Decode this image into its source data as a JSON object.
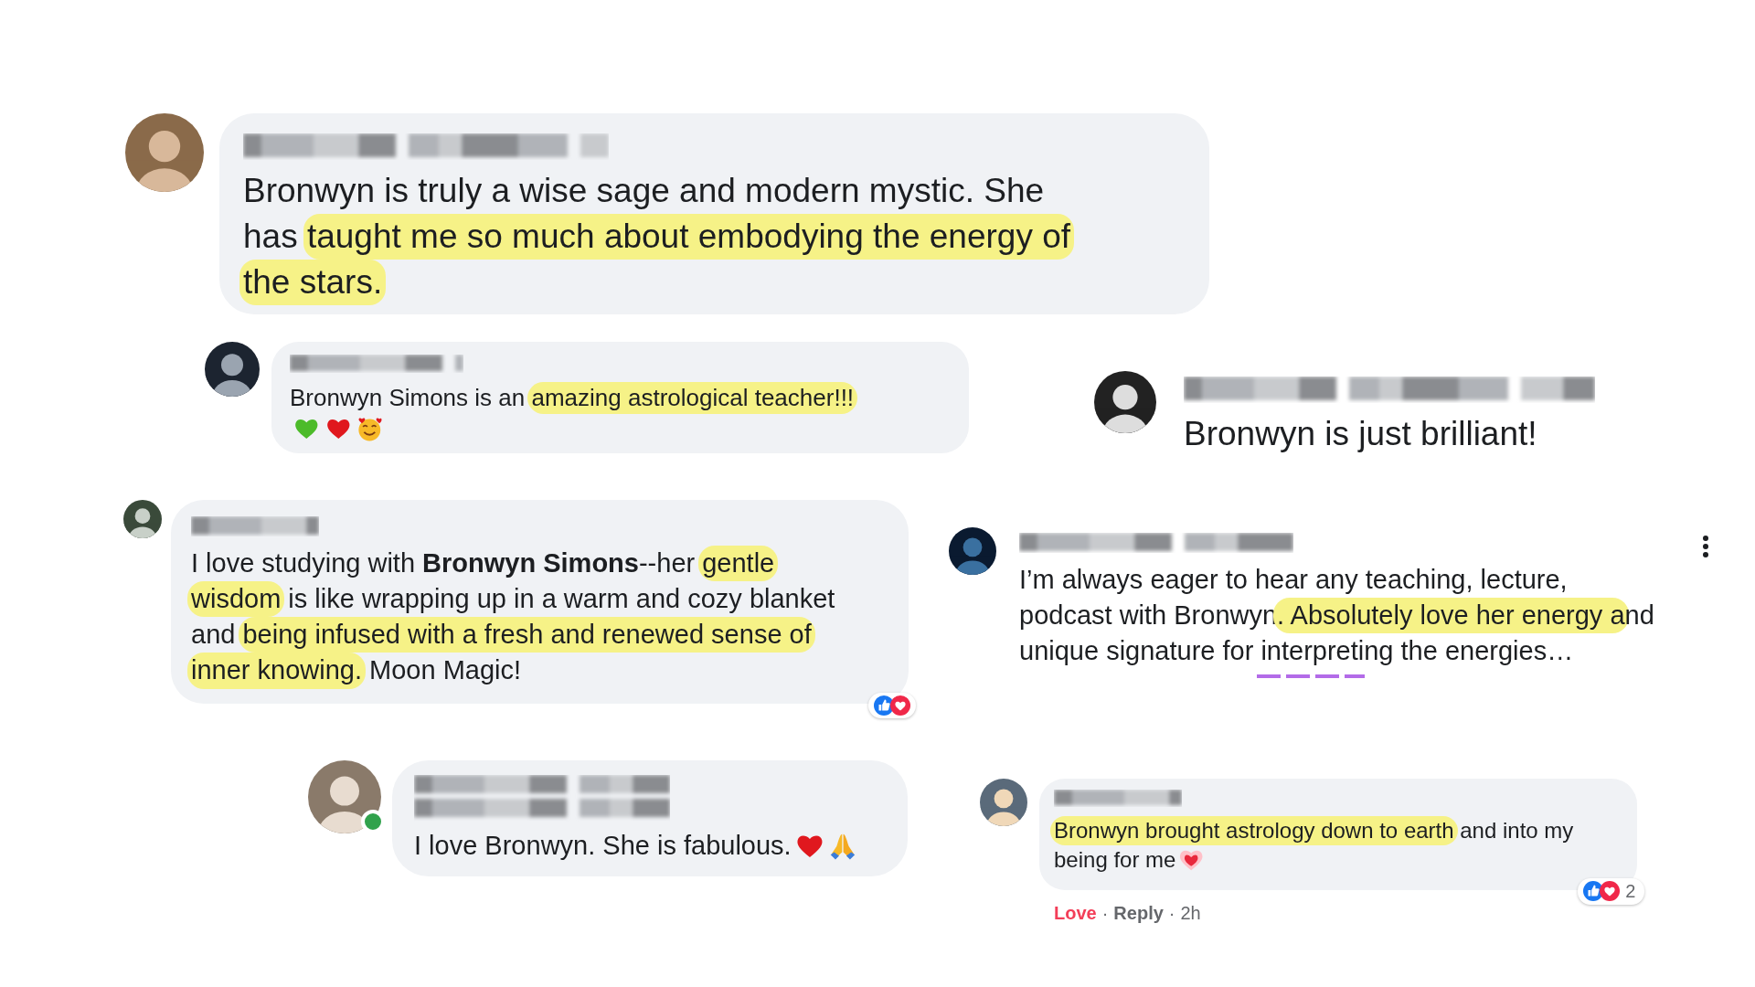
{
  "comments": [
    {
      "kind": "bubble",
      "lines": [
        [
          {
            "text": "Bronwyn is truly a wise sage and modern mystic. She",
            "highlighted": false
          }
        ],
        [
          {
            "text": "has ",
            "highlighted": false
          },
          {
            "text": "taught me so much about embodying the energy of",
            "highlighted": true
          }
        ],
        [
          {
            "text": "the stars.",
            "highlighted": true
          }
        ]
      ]
    },
    {
      "kind": "bubble",
      "lines": [
        [
          {
            "text": "Bronwyn Simons is an ",
            "highlighted": false
          },
          {
            "text": "amazing astrological teacher!!!",
            "highlighted": true
          }
        ]
      ]
    },
    {
      "kind": "plain",
      "lines": [
        [
          {
            "text": "Bronwyn is just brilliant!",
            "highlighted": false
          }
        ]
      ]
    },
    {
      "kind": "bubble",
      "lines": [
        [
          {
            "text": "I love studying with **Bronwyn Simons**--her ",
            "highlighted": false
          },
          {
            "text": "gentle",
            "highlighted": true
          }
        ],
        [
          {
            "text": "wisdom",
            "highlighted": true
          },
          {
            "text": " is like wrapping up in a warm and cozy blanket",
            "highlighted": false
          }
        ],
        [
          {
            "text": "and ",
            "highlighted": false
          },
          {
            "text": "being infused with a fresh and renewed sense of",
            "highlighted": true
          }
        ],
        [
          {
            "text": "inner knowing.",
            "highlighted": true
          },
          {
            "text": " Moon Magic!",
            "highlighted": false
          }
        ]
      ]
    },
    {
      "kind": "plain",
      "lines": [
        [
          {
            "text": "I’m always eager to hear any teaching, lecture,",
            "highlighted": false
          }
        ],
        [
          {
            "text": "podcast with Bronwyn",
            "highlighted": false
          },
          {
            "text": ". Absolutely love her energy a",
            "highlighted": true
          },
          {
            "text": "nd",
            "highlighted": false
          }
        ],
        [
          {
            "text": "unique signature for interpreting the energies…",
            "highlighted": false
          }
        ]
      ]
    },
    {
      "kind": "bubble",
      "online": true,
      "lines": [
        [
          {
            "text": "I love Bronwyn. She is fabulous.",
            "highlighted": false
          }
        ]
      ]
    },
    {
      "kind": "bubble",
      "lines": [
        [
          {
            "text": "Bronwyn brought astrology down to earth",
            "highlighted": true
          },
          {
            "text": " and into my",
            "highlighted": false
          }
        ],
        [
          {
            "text": "being for me",
            "highlighted": false
          }
        ]
      ],
      "reaction_count": "2",
      "actions": [
        {
          "label": "Love",
          "selected": true
        },
        {
          "label": "Reply",
          "selected": false
        }
      ],
      "separator": "·",
      "time": "2h"
    }
  ]
}
